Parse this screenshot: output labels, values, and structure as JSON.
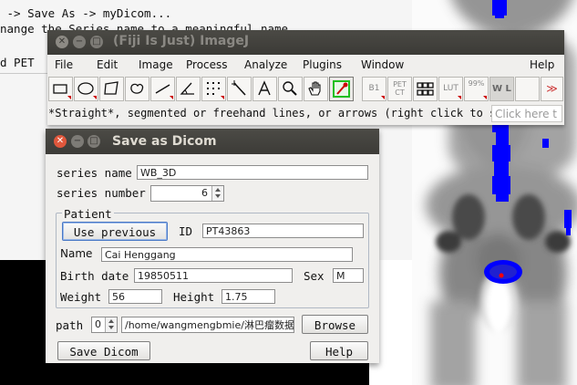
{
  "terminal": {
    "line1": " -> Save As -> myDicom...",
    "line2": "nange the Series name to a meaningful name",
    "line3": "d PET"
  },
  "imagej": {
    "title": "(Fiji Is Just) ImageJ",
    "menu": [
      "File",
      "Edit",
      "Image",
      "Process",
      "Analyze",
      "Plugins",
      "Window",
      "Help"
    ],
    "tools": {
      "rectangle": "rectangle-tool-icon",
      "oval": "oval-tool-icon",
      "polygon": "polygon-tool-icon",
      "freehand": "freehand-tool-icon",
      "line": "straight-line-tool-icon",
      "angle": "angle-tool-icon",
      "point": "multi-point-tool-icon",
      "wand": "wand-tool-icon",
      "text": "text-tool-icon",
      "magnifier": "magnifier-tool-icon",
      "hand": "hand-tool-icon",
      "dropper": "color-picker-tool-icon",
      "b1_label": "B1",
      "petct_label": "PET CT",
      "grid": "grid-layout-icon",
      "lut_label": "LUT",
      "pct_label": "99%",
      "wl_label": "W L",
      "more": "more-tools-icon"
    },
    "status": "*Straight*, segmented or freehand lines, or arrows (right click to switch)",
    "click_here": "Click here t"
  },
  "dialog": {
    "title": "Save as Dicom",
    "series_name_label": "series name",
    "series_name_value": "WB_3D",
    "series_number_label": "series number",
    "series_number_value": "6",
    "patient_legend": "Patient",
    "use_previous_label": "Use previous",
    "id_label": "ID",
    "id_value": "PT43863",
    "name_label": "Name",
    "name_value": "Cai Henggang",
    "birth_label": "Birth date",
    "birth_value": "19850511",
    "sex_label": "Sex",
    "sex_value": "M",
    "weight_label": "Weight",
    "weight_value": "56",
    "height_label": "Height",
    "height_value": "1.75",
    "path_label": "path",
    "path_spinner_value": "0",
    "path_value": "/home/wangmengbmie/淋巴瘤数据库",
    "browse_label": "Browse",
    "save_label": "Save Dicom",
    "help_label": "Help"
  },
  "colors": {
    "title_bar": "#3c3b37",
    "close_active": "#e0573c",
    "blue_overlay": "#0000ff",
    "red_marker": "#ff0000"
  }
}
